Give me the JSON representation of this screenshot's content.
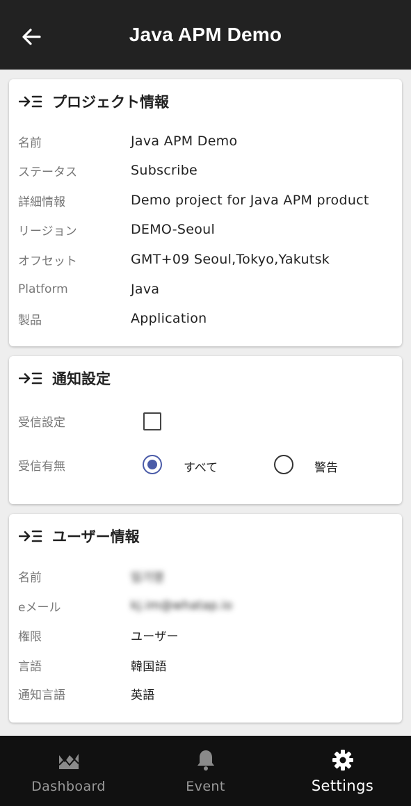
{
  "appbar": {
    "title": "Java APM Demo",
    "back_icon": "arrow-left-icon"
  },
  "project": {
    "title": "プロジェクト情報",
    "rows": [
      {
        "label": "名前",
        "value": "Java APM Demo"
      },
      {
        "label": "ステータス",
        "value": "Subscribe"
      },
      {
        "label": "詳細情報",
        "value": "Demo project for Java APM product"
      },
      {
        "label": "リージョン",
        "value": "DEMO-Seoul"
      },
      {
        "label": "オフセット",
        "value": "GMT+09 Seoul,Tokyo,Yakutsk"
      },
      {
        "label": "Platform",
        "value": "Java"
      },
      {
        "label": "製品",
        "value": "Application"
      }
    ]
  },
  "notification": {
    "title": "通知設定",
    "receive_label": "受信設定",
    "receive_checked": false,
    "mode_label": "受信有無",
    "options": [
      {
        "label": "すべて",
        "selected": true
      },
      {
        "label": "警告",
        "selected": false
      }
    ]
  },
  "user": {
    "title": "ユーザー情報",
    "rows": [
      {
        "label": "名前",
        "value": "임기영",
        "blurred": true
      },
      {
        "label": "eメール",
        "value": "kj.im@whatap.io",
        "blurred": true
      },
      {
        "label": "権限",
        "value": "ユーザー"
      },
      {
        "label": "言語",
        "value": "韓国語"
      },
      {
        "label": "通知言語",
        "value": "英語"
      }
    ]
  },
  "nav": {
    "items": [
      {
        "label": "Dashboard",
        "icon": "dashboard-icon"
      },
      {
        "label": "Event",
        "icon": "bell-icon"
      },
      {
        "label": "Settings",
        "icon": "gear-icon",
        "active": true
      }
    ]
  },
  "colors": {
    "appbar": "#222222",
    "accent": "#4a5ba8",
    "nav_bg": "#111111"
  }
}
